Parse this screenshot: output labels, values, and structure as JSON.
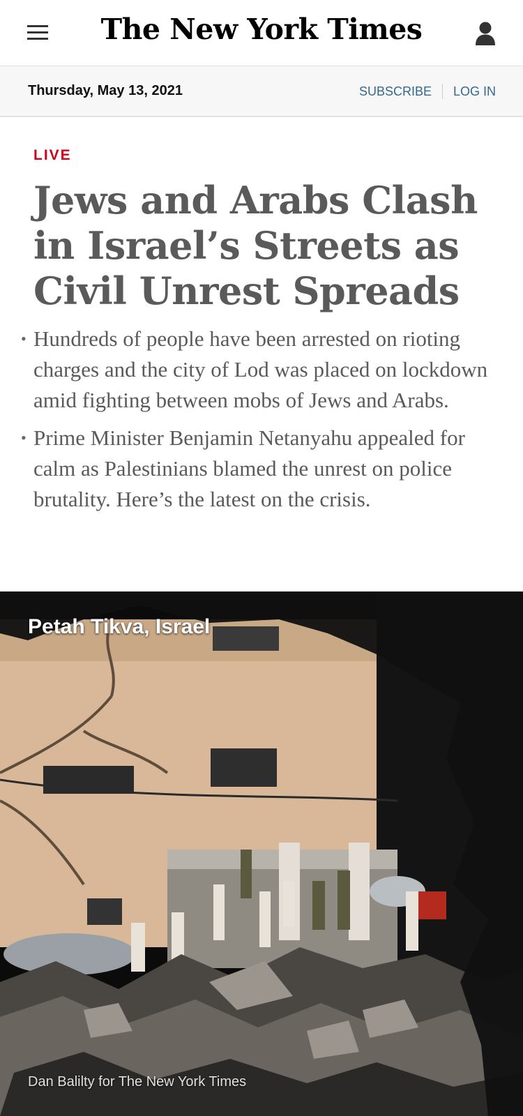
{
  "header": {
    "logo_text": "The New York Times",
    "menu_icon": "hamburger-menu-icon",
    "account_icon": "user-account-icon"
  },
  "datebar": {
    "date": "Thursday, May 13, 2021",
    "subscribe_label": "SUBSCRIBE",
    "login_label": "LOG IN"
  },
  "article": {
    "badge": "LIVE",
    "headline": "Jews and Arabs Clash in Israel’s Streets as Civil Unrest Spreads",
    "bullets": [
      "Hundreds of people have been arrested on rioting charges and the city of Lod was placed on lockdown amid fighting between mobs of Jews and Arabs.",
      "Prime Minister Benjamin Netanyahu appealed for calm as Palestinians blamed the unrest on police brutality. Here’s the latest on the crisis."
    ]
  },
  "photo": {
    "location_label": "Petah Tikva, Israel",
    "credit": "Dan Balilty for The New York Times"
  },
  "colors": {
    "link": "#326891",
    "live": "#d0021b",
    "headline": "#5a5a5a"
  }
}
